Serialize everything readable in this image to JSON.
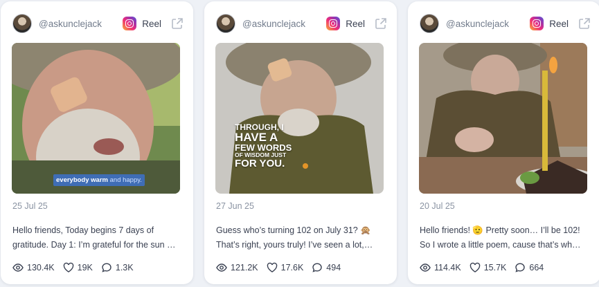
{
  "cards": [
    {
      "handle": "@askunclejack",
      "platform_label": "Reel",
      "overlay": {
        "main": "everybody warm",
        "soft": "and happy."
      },
      "date": "25 Jul 25",
      "desc_line1": "Hello friends, Today begins 7 days of",
      "desc_line2": "gratitude. Day 1: I’m grateful for the sun …",
      "views": "130.4K",
      "likes": "19K",
      "comments": "1.3K"
    },
    {
      "handle": "@askunclejack",
      "platform_label": "Reel",
      "overlay": {
        "l1": "THROUGH, I",
        "l2": "HAVE A",
        "l3": "FEW WORDS",
        "l4": "OF WISDOM JUST",
        "l5": "FOR YOU."
      },
      "date": "27 Jun 25",
      "desc_line1": "Guess who’s turning 102 on July 31? 🙊",
      "desc_line2": "That’s right, yours truly! I’ve seen a lot,…",
      "views": "121.2K",
      "likes": "17.6K",
      "comments": "494"
    },
    {
      "handle": "@askunclejack",
      "platform_label": "Reel",
      "date": "20 Jul 25",
      "desc_line1": "Hello friends! 🫡 Pretty soon… I’ll be 102!",
      "desc_line2": "So I wrote a little poem, cause that’s wh…",
      "views": "114.4K",
      "likes": "15.7K",
      "comments": "664"
    }
  ],
  "icons": {
    "platform": "instagram-icon",
    "external": "external-link-icon",
    "views": "eye-icon",
    "likes": "heart-icon",
    "comments": "comment-icon"
  },
  "colors": {
    "page_bg": "#eef1f6",
    "card_bg": "#ffffff",
    "text": "#3a4152",
    "muted": "#8a93a2",
    "caption_bg": "#3f6db5"
  }
}
